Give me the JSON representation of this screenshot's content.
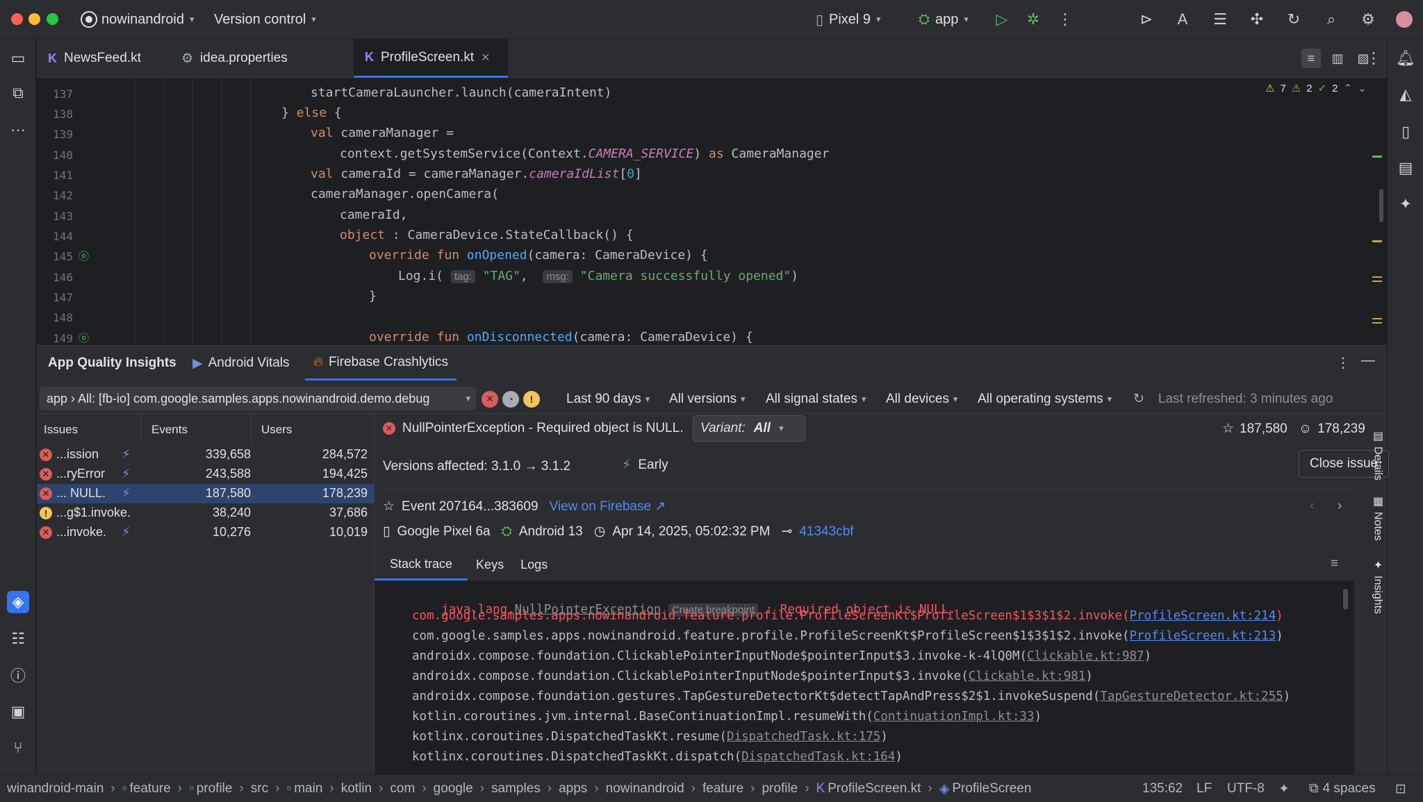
{
  "titlebar": {
    "project": "nowinandroid",
    "vcs": "Version control",
    "device": "Pixel 9",
    "run_config": "app"
  },
  "tabs": [
    {
      "label": "NewsFeed.kt"
    },
    {
      "label": "idea.properties"
    },
    {
      "label": "ProfileScreen.kt"
    }
  ],
  "editor": {
    "inspections": {
      "warnings": "7",
      "weak_warnings": "2",
      "ok": "2"
    },
    "lines": [
      "137",
      "138",
      "139",
      "140",
      "141",
      "142",
      "143",
      "144",
      "145",
      "146",
      "147",
      "148",
      "149"
    ]
  },
  "aqi": {
    "title": "App Quality Insights",
    "tabs": [
      "Android Vitals",
      "Firebase Crashlytics"
    ],
    "app_selector": "app › All: [fb-io] com.google.samples.apps.nowinandroid.demo.debug",
    "filters": {
      "time": "Last 90 days",
      "versions": "All versions",
      "signals": "All signal states",
      "devices": "All devices",
      "os": "All operating systems",
      "refreshed": "Last refreshed: 3 minutes ago"
    },
    "issues_header": {
      "issues": "Issues",
      "events": "Events",
      "users": "Users"
    },
    "issues": [
      {
        "name": "...ission",
        "events": "339,658",
        "users": "284,572",
        "type": "error"
      },
      {
        "name": "...ryError",
        "events": "243,588",
        "users": "194,425",
        "type": "error"
      },
      {
        "name": "... NULL.",
        "events": "187,580",
        "users": "178,239",
        "type": "error"
      },
      {
        "name": "...g$1.invoke.",
        "events": "38,240",
        "users": "37,686",
        "type": "warning"
      },
      {
        "name": "...invoke.",
        "events": "10,276",
        "users": "10,019",
        "type": "error"
      }
    ],
    "detail": {
      "title": "NullPointerException - Required object is NULL.",
      "variant_label": "Variant:",
      "variant_value": "All",
      "events_count": "187,580",
      "users_count": "178,239",
      "versions": "Versions affected: 3.1.0 → 3.1.2",
      "signal": "Early",
      "close_button": "Close issue",
      "event_id": "Event 207164...383609",
      "view_on_firebase": "View on Firebase ↗",
      "device": "Google Pixel 6a",
      "os": "Android 13",
      "date": "Apr 14, 2025, 05:02:32 PM",
      "commit": "41343cbf",
      "subtabs": [
        "Stack trace",
        "Keys",
        "Logs"
      ],
      "exception_class": "NullPointerException",
      "exception_prefix": "java.lang.",
      "create_breakpoint": "Create breakpoint",
      "exception_msg": ": Required object is NULL.",
      "frames": [
        {
          "text": "com.google.samples.apps.nowinandroid.feature.profile.ProfileScreenKt$ProfileScreen$1$3$1$2.invoke(",
          "link": "ProfileScreen.kt:214",
          "kind": "app-red"
        },
        {
          "text": "com.google.samples.apps.nowinandroid.feature.profile.ProfileScreenKt$ProfileScreen$1$3$1$2.invoke(",
          "link": "ProfileScreen.kt:213",
          "kind": "app"
        },
        {
          "text": "androidx.compose.foundation.ClickablePointerInputNode$pointerInput$3.invoke-k-4lQ0M(",
          "link": "Clickable.kt:987",
          "kind": "lib"
        },
        {
          "text": "androidx.compose.foundation.ClickablePointerInputNode$pointerInput$3.invoke(",
          "link": "Clickable.kt:981",
          "kind": "lib"
        },
        {
          "text": "androidx.compose.foundation.gestures.TapGestureDetectorKt$detectTapAndPress$2$1.invokeSuspend(",
          "link": "TapGestureDetector.kt:255",
          "kind": "lib"
        },
        {
          "text": "kotlin.coroutines.jvm.internal.BaseContinuationImpl.resumeWith(",
          "link": "ContinuationImpl.kt:33",
          "kind": "lib"
        },
        {
          "text": "kotlinx.coroutines.DispatchedTaskKt.resume(",
          "link": "DispatchedTask.kt:175",
          "kind": "lib"
        },
        {
          "text": "kotlinx.coroutines.DispatchedTaskKt.dispatch(",
          "link": "DispatchedTask.kt:164",
          "kind": "lib"
        }
      ]
    },
    "side_tabs": [
      "Details",
      "Notes",
      "Insights"
    ]
  },
  "status": {
    "path": [
      "winandroid-main",
      "feature",
      "profile",
      "src",
      "main",
      "kotlin",
      "com",
      "google",
      "samples",
      "apps",
      "nowinandroid",
      "feature",
      "profile",
      "ProfileScreen.kt",
      "ProfileScreen"
    ],
    "position": "135:62",
    "line_sep": "LF",
    "encoding": "UTF-8",
    "indent": "4 spaces"
  },
  "colors": {
    "accent": "#3574f0",
    "error": "#db5c5c",
    "warning": "#f2c55c",
    "selection": "#2e436e"
  }
}
